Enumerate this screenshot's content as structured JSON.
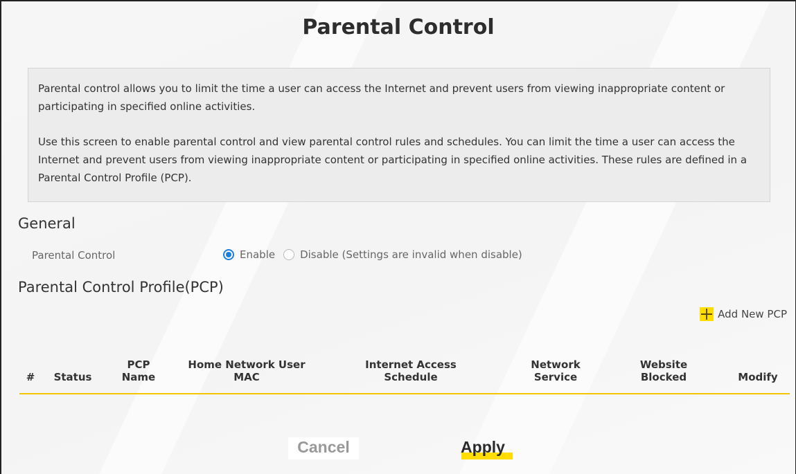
{
  "page": {
    "title": "Parental Control"
  },
  "description": {
    "paragraph1": "Parental control allows you to limit the time a user can access the Internet and prevent users from viewing inappropriate content or participating in specified online activities.",
    "paragraph2": "Use this screen to enable parental control and view parental control rules and schedules. You can limit the time a user can access the Internet and prevent users from viewing inappropriate content or participating in specified online activities. These rules are defined in a Parental Control Profile (PCP)."
  },
  "general": {
    "title": "General",
    "parental_control_label": "Parental Control",
    "options": [
      {
        "label": "Enable",
        "checked": true
      },
      {
        "label": "Disable (Settings are invalid when disable)",
        "checked": false
      }
    ]
  },
  "pcp": {
    "title": "Parental Control Profile(PCP)",
    "add_label": "Add New PCP",
    "columns": {
      "index": "#",
      "status": "Status",
      "pcp_name_1": "PCP",
      "pcp_name_2": "Name",
      "user_mac_1": "Home Network User",
      "user_mac_2": "MAC",
      "schedule_1": "Internet Access",
      "schedule_2": "Schedule",
      "service_1": "Network",
      "service_2": "Service",
      "blocked_1": "Website",
      "blocked_2": "Blocked",
      "modify": "Modify"
    },
    "rows": []
  },
  "buttons": {
    "cancel": "Cancel",
    "apply": "Apply"
  },
  "colors": {
    "accent": "#ffdd00",
    "radio": "#1e7fd6",
    "table_rule": "#f5c400"
  }
}
